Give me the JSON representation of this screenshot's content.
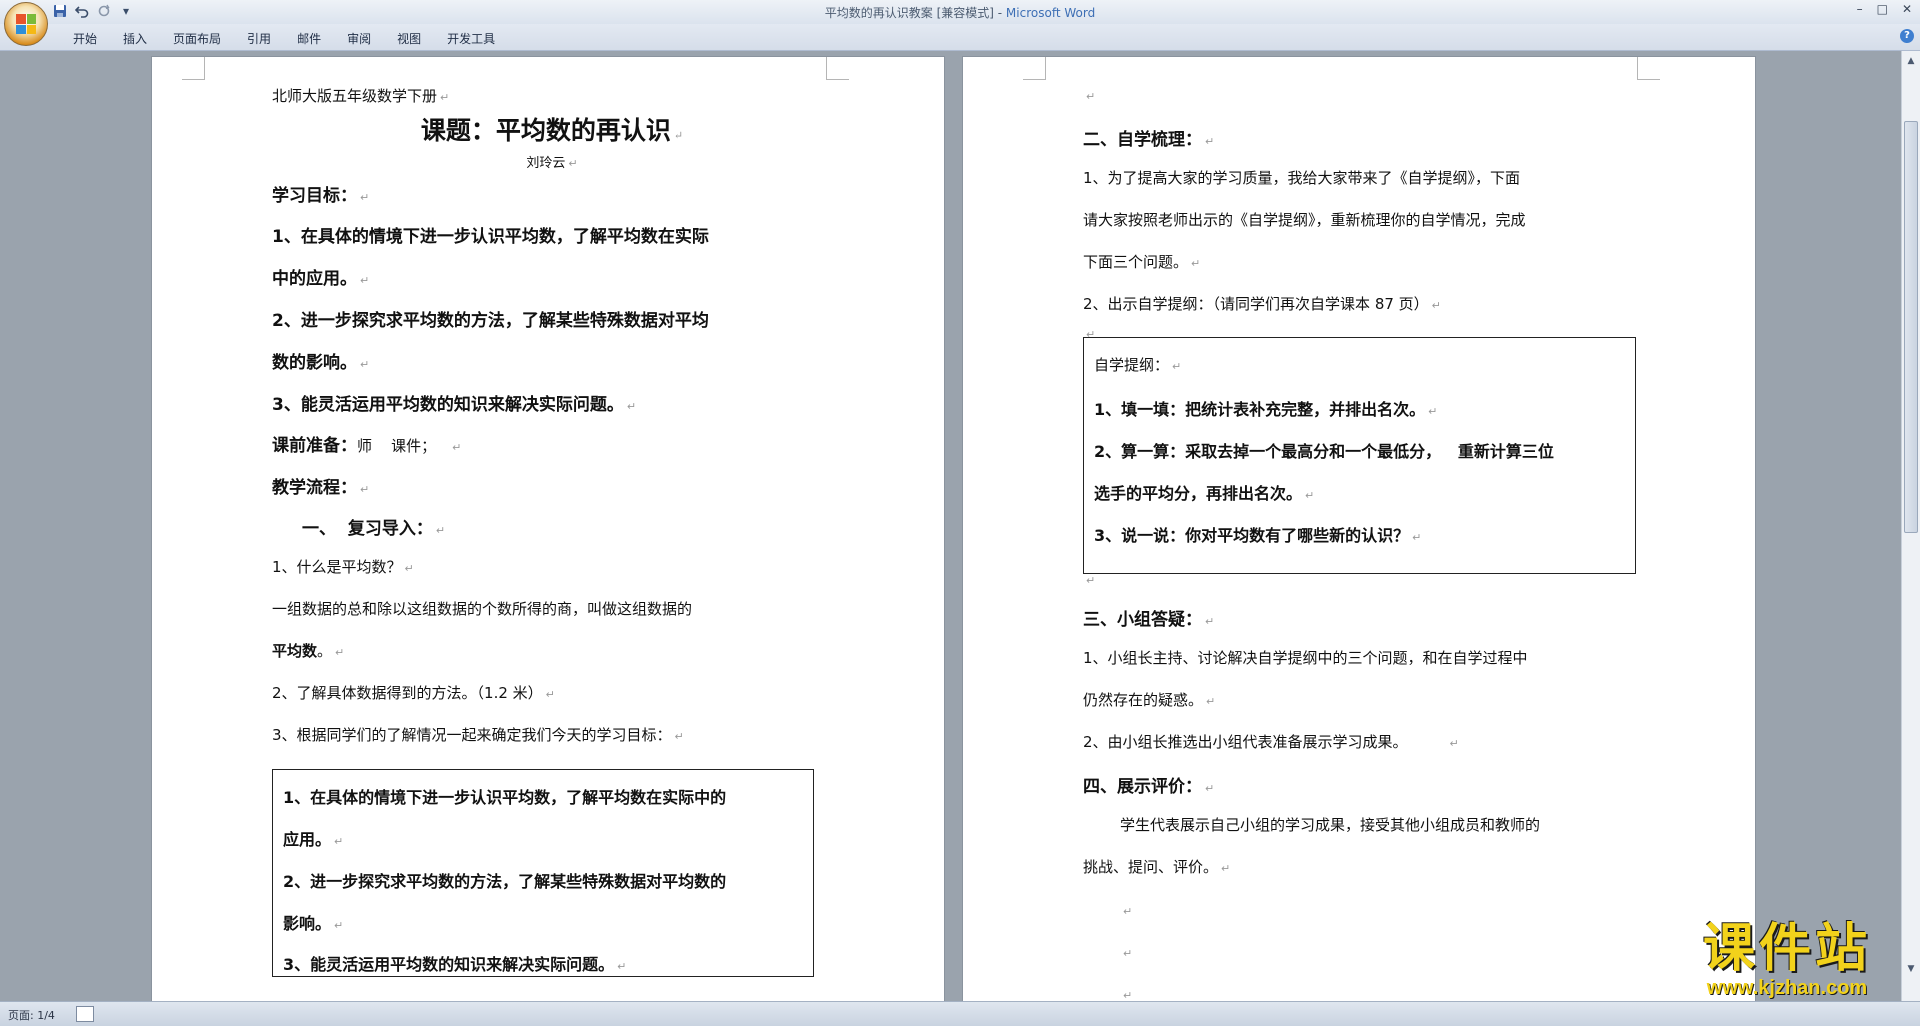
{
  "window": {
    "title": "平均数的再认识教案 [兼容模式] - ",
    "app_name": "Microsoft Word",
    "controls": [
      "–",
      "□",
      "✕"
    ]
  },
  "qat": {
    "save_icon": "save-icon",
    "undo_icon": "undo-icon",
    "redo_icon": "redo-icon",
    "customize_icon": "▾"
  },
  "ribbon": {
    "tabs": [
      "开始",
      "插入",
      "页面布局",
      "引用",
      "邮件",
      "审阅",
      "视图",
      "开发工具"
    ],
    "help": "?"
  },
  "page1": {
    "header": "北师大版五年级数学下册",
    "title": "课题：平均数的再认识",
    "author": "刘玲云",
    "goals_heading": "学习目标：",
    "goal1_l1": "1、在具体的情境下进一步认识平均数，了解平均数在实际",
    "goal1_l2": "中的应用。",
    "goal2_l1": "2、进一步探究求平均数的方法，了解某些特殊数据对平均",
    "goal2_l2": "数的影响。",
    "goal3": "3、能灵活运用平均数的知识来解决实际问题。",
    "prep_label": "课前准备：",
    "prep_value": "师    课件；",
    "flow_heading": "教学流程：",
    "sec1": "一、  复习导入：",
    "q1": "1、什么是平均数？",
    "def_l1": "一组数据的总和除以这组数据的个数所得的商，叫做这组数据的",
    "def_l2_bold": "平均数",
    "def_l2_end": "。",
    "q2": "2、了解具体数据得到的方法。（1.2 米）",
    "q3": "3、根据同学们的了解情况一起来确定我们今天的学习目标：",
    "box_l1": "1、在具体的情境下进一步认识平均数，了解平均数在实际中的",
    "box_l2": "应用。",
    "box_l3": "2、进一步探究求平均数的方法，了解某些特殊数据对平均数的",
    "box_l4": "影响。",
    "box_l5": "3、能灵活运用平均数的知识来解决实际问题。"
  },
  "page2": {
    "sec2": "二、自学梳理：",
    "p1_l1": "1、为了提高大家的学习质量，我给大家带来了《自学提纲》，下面",
    "p1_l2": "请大家按照老师出示的《自学提纲》，重新梳理你的自学情况，完成",
    "p1_l3": "下面三个问题。",
    "p2": "2、出示自学提纲：（请同学们再次自学课本 87 页）",
    "box_title": "自学提纲：",
    "box_l1": "1、填一填：把统计表补充完整，并排出名次。",
    "box_l2": "2、算一算：采取去掉一个最高分和一个最低分，   重新计算三位",
    "box_l3": "选手的平均分，再排出名次。",
    "box_l4": "3、说一说：你对平均数有了哪些新的认识？",
    "sec3": "三、小组答疑：",
    "p3_l1": "1、小组长主持、讨论解决自学提纲中的三个问题，和在自学过程中",
    "p3_l2": "仍然存在的疑惑。",
    "p4": "2、由小组长推选出小组代表准备展示学习成果。",
    "sec4": "四、展示评价：",
    "p5_l1": "学生代表展示自己小组的学习成果，接受其他小组成员和教师的",
    "p5_l2": "挑战、提问、评价。"
  },
  "para_mark": "↵",
  "status": {
    "page": "页面: 1/4"
  },
  "watermark": {
    "title": "课件站",
    "url": "www.kjzhan.com"
  }
}
